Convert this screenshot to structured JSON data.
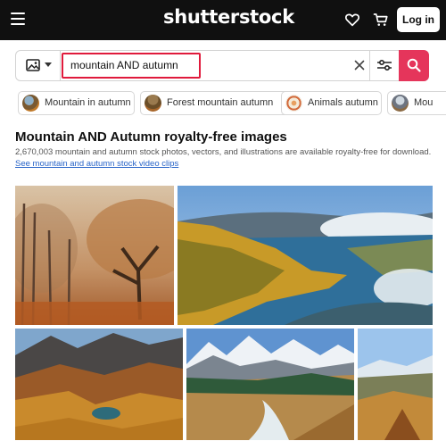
{
  "header": {
    "logo": "shutterstock",
    "login_label": "Log in",
    "icons": [
      "menu-icon",
      "heart-icon",
      "cart-icon"
    ]
  },
  "search": {
    "type_icon": "image-icon",
    "query": "mountain AND autumn",
    "icons": [
      "clear-icon",
      "filter-icon",
      "search-icon"
    ],
    "accent_color": "#e5355b",
    "highlight_color": "#e01a3c"
  },
  "chips": [
    {
      "label": "Mountain in autumn"
    },
    {
      "label": "Forest mountain autumn"
    },
    {
      "label": "Animals autumn"
    },
    {
      "label": "Mou"
    }
  ],
  "results": {
    "title": "Mountain AND Autumn royalty-free images",
    "description": "2,670,003 mountain and autumn stock photos, vectors, and illustrations are available royalty-free for download.",
    "video_link": "See mountain and autumn stock video clips"
  }
}
